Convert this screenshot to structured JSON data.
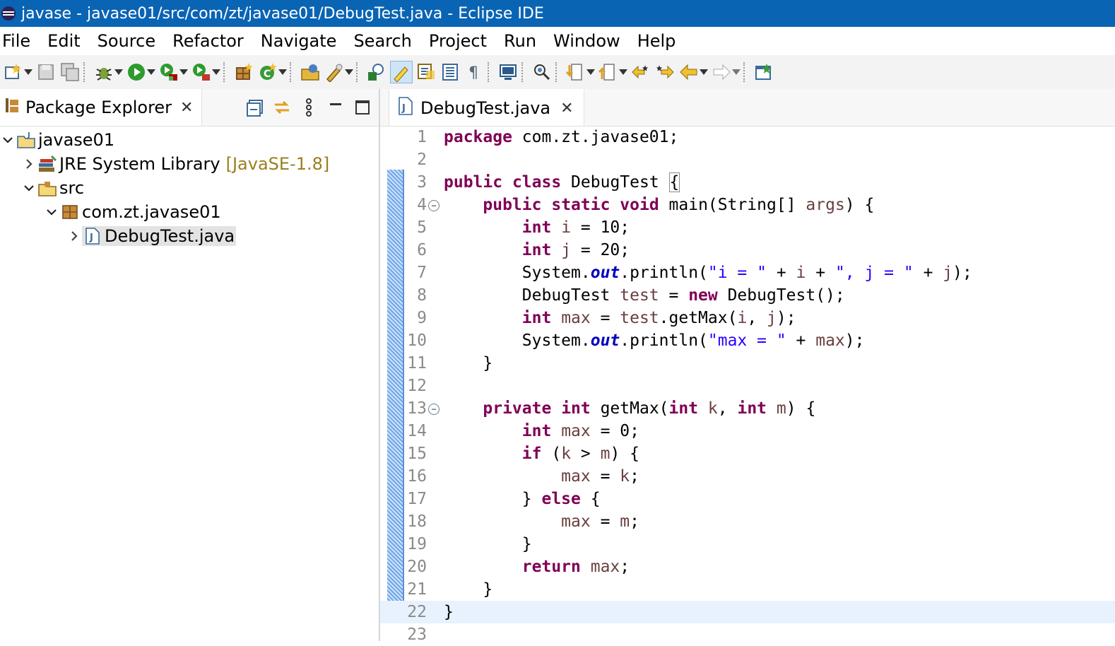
{
  "window": {
    "title": "javase - javase01/src/com/zt/javase01/DebugTest.java - Eclipse IDE",
    "title_bg": "#0a64b4"
  },
  "menu": {
    "items": [
      "File",
      "Edit",
      "Source",
      "Refactor",
      "Navigate",
      "Search",
      "Project",
      "Run",
      "Window",
      "Help"
    ]
  },
  "toolbar": {
    "icons": [
      "new-wizard-icon",
      "save-icon",
      "save-all-icon",
      "debug-icon",
      "run-icon",
      "coverage-icon",
      "run-external-tool-icon",
      "new-java-package-icon",
      "new-java-class-icon",
      "open-type-icon",
      "search-icon",
      "open-task-icon",
      "toggle-mark-occurrences-icon",
      "toggle-block-selection-icon",
      "show-whitespace-icon",
      "open-console-icon",
      "skip-breakpoints-icon",
      "next-annotation-icon",
      "previous-annotation-icon",
      "last-edit-location-icon",
      "back-icon",
      "forward-icon",
      "open-perspective-icon"
    ]
  },
  "package_explorer": {
    "tab_label": "Package Explorer",
    "tree": [
      {
        "label": "javase01",
        "depth": 0,
        "expanded": true,
        "icon": "java-project-icon"
      },
      {
        "label": "JRE System Library",
        "decor": "[JavaSE-1.8]",
        "depth": 1,
        "expanded": false,
        "icon": "library-icon"
      },
      {
        "label": "src",
        "depth": 1,
        "expanded": true,
        "icon": "source-folder-icon"
      },
      {
        "label": "com.zt.javase01",
        "depth": 2,
        "expanded": true,
        "icon": "package-icon"
      },
      {
        "label": "DebugTest.java",
        "depth": 3,
        "expanded": false,
        "icon": "java-file-icon",
        "selected": true
      }
    ]
  },
  "editor": {
    "tab_label": "DebugTest.java",
    "line_numbers": [
      "1",
      "2",
      "3",
      "4",
      "5",
      "6",
      "7",
      "8",
      "9",
      "10",
      "11",
      "12",
      "13",
      "14",
      "15",
      "16",
      "17",
      "18",
      "19",
      "20",
      "21",
      "22",
      "23"
    ],
    "lines": [
      "package com.zt.javase01;",
      "",
      "public class DebugTest {",
      "    public static void main(String[] args) {",
      "        int i = 10;",
      "        int j = 20;",
      "        System.out.println(\"i = \" + i + \", j = \" + j);",
      "        DebugTest test = new DebugTest();",
      "        int max = test.getMax(i, j);",
      "        System.out.println(\"max = \" + max);",
      "    }",
      "",
      "    private int getMax(int k, int m) {",
      "        int max = 0;",
      "        if (k > m) {",
      "            max = k;",
      "        } else {",
      "            max = m;",
      "        }",
      "        return max;",
      "    }",
      "}",
      ""
    ]
  }
}
